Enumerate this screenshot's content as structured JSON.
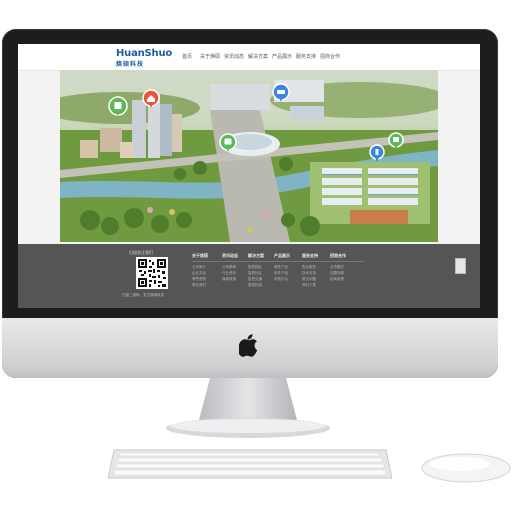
{
  "site": {
    "logo_text": "HuanShuo",
    "logo_subtitle": "焕硕科技",
    "nav": [
      "首页",
      "关于焕硕",
      "资讯动态",
      "解决方案",
      "产品展示",
      "服务支持",
      "招商合作"
    ]
  },
  "hero": {
    "pins": [
      {
        "color": "#5cb85c",
        "icon": "document-icon"
      },
      {
        "color": "#e8553e",
        "icon": "home-icon"
      },
      {
        "color": "#3d87d9",
        "icon": "car-icon"
      },
      {
        "color": "#5cb85c",
        "icon": "bus-icon"
      },
      {
        "color": "#3d87d9",
        "icon": "info-icon"
      },
      {
        "color": "#5cb85c",
        "icon": "bus-icon"
      }
    ]
  },
  "footer": {
    "qr_caption_top": "扫描关注我们",
    "qr_caption_bottom": "扫描二维码，关注焕硕科技",
    "columns": [
      {
        "title": "关于焕硕",
        "links": [
          "公司简介",
          "企业文化",
          "荣誉资质",
          "联系我们"
        ]
      },
      {
        "title": "资讯动态",
        "links": [
          "公司新闻",
          "行业资讯",
          "媒体报道"
        ]
      },
      {
        "title": "解决方案",
        "links": [
          "智慧园区",
          "智慧社区",
          "智慧交通",
          "智慧校园"
        ]
      },
      {
        "title": "产品展示",
        "links": [
          "硬件产品",
          "软件产品",
          "系统平台"
        ]
      },
      {
        "title": "服务支持",
        "links": [
          "售后服务",
          "技术支持",
          "常见问题",
          "资料下载"
        ]
      },
      {
        "title": "招商合作",
        "links": [
          "合作模式",
          "加盟流程",
          "招商政策"
        ]
      }
    ]
  },
  "colors": {
    "brand": "#1e5aa8",
    "footer_bg": "#555555",
    "bezel": "#1d1d1d",
    "aluminum": "#d9dadc"
  }
}
